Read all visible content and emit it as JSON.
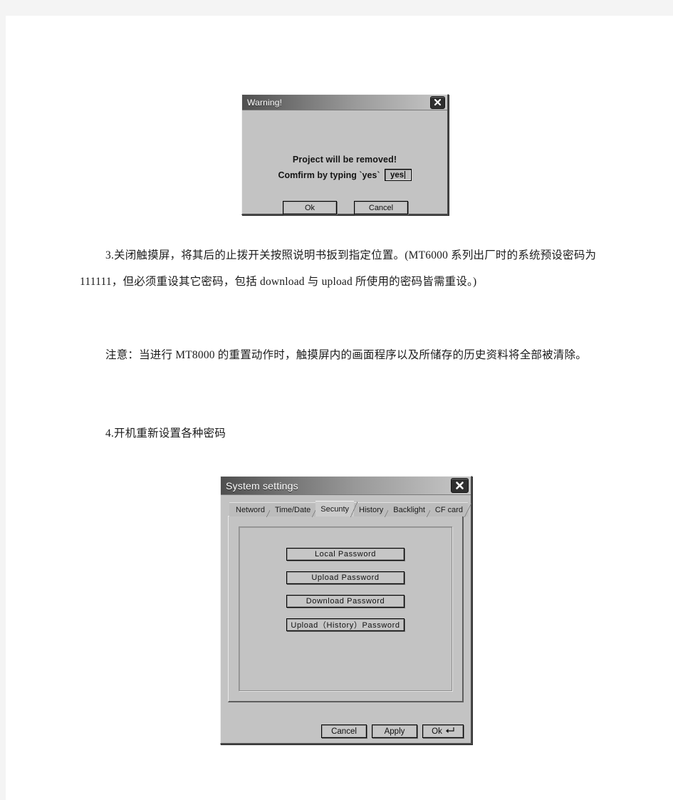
{
  "document": {
    "paragraphs": {
      "step3": "3.关闭触摸屏，将其后的止拨开关按照说明书扳到指定位置。(MT6000 系列出厂时的系统预设密码为 111111，但必须重设其它密码，包括 download 与 upload 所使用的密码皆需重设。)",
      "note": "注意：当进行 MT8000 的重置动作时，触摸屏内的画面程序以及所储存的历史资料将全部被清除。",
      "step4": "4.开机重新设置各种密码"
    }
  },
  "warning_dialog": {
    "title": "Warning!",
    "close_icon": "close-icon",
    "message_line1": "Project will be removed!",
    "message_line2": "Comfirm by typing `yes`",
    "confirm_input_value": "yes",
    "buttons": {
      "ok": "Ok",
      "cancel": "Cancel"
    }
  },
  "system_settings_dialog": {
    "title": "System settings",
    "close_icon": "close-icon",
    "tabs": [
      {
        "label": "Netword",
        "active": false
      },
      {
        "label": "Time/Date",
        "active": false
      },
      {
        "label": "Secunty",
        "active": true
      },
      {
        "label": "History",
        "active": false
      },
      {
        "label": "Backlight",
        "active": false
      },
      {
        "label": "CF card",
        "active": false
      }
    ],
    "security_panel": {
      "buttons": [
        "Local  Password",
        "Upload  Password",
        "Download  Password",
        "Upload（History）Password"
      ]
    },
    "footer_buttons": {
      "cancel": "Cancel",
      "apply": "Apply",
      "ok": "Ok",
      "ok_icon": "enter-arrow-icon"
    }
  },
  "colors": {
    "page_background": "#ffffff",
    "canvas_background": "#f4f4f4",
    "dialog_face": "#c3c3c3",
    "titlebar_dark": "#4f4f4f",
    "titlebar_light": "#c8c8c8",
    "text": "#1b1b1b"
  }
}
